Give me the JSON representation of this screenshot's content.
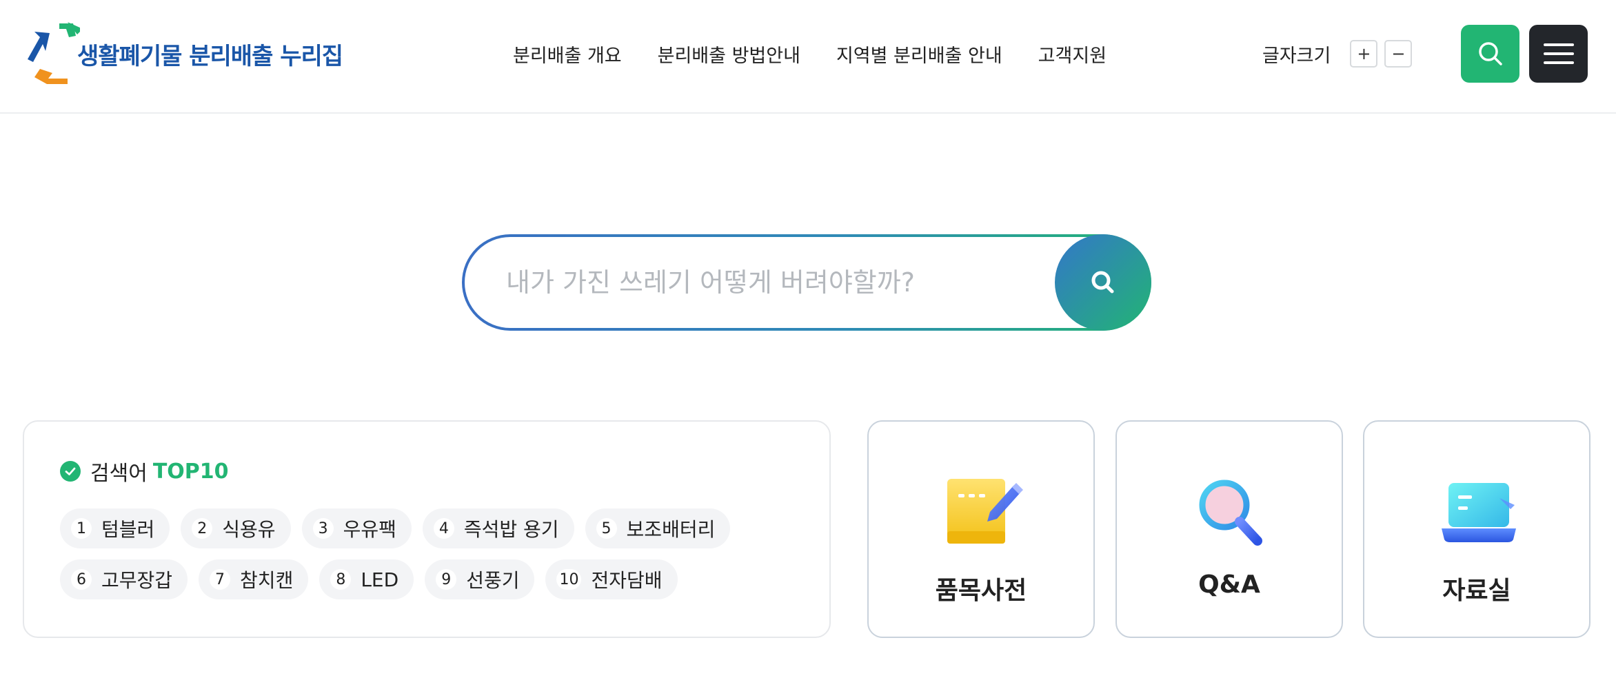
{
  "header": {
    "logo_text": "생활폐기물 분리배출 누리집",
    "nav": [
      {
        "label": "분리배출 개요"
      },
      {
        "label": "분리배출 방법안내"
      },
      {
        "label": "지역별 분리배출 안내"
      },
      {
        "label": "고객지원"
      }
    ],
    "font_size": {
      "label": "글자크기",
      "increase": "+",
      "decrease": "−"
    },
    "search_icon": "search-icon",
    "menu_icon": "hamburger-menu-icon"
  },
  "search": {
    "placeholder": "내가 가진 쓰레기 어떻게 버려야할까?",
    "value": "",
    "submit_icon": "search-icon"
  },
  "top10": {
    "title": "검색어",
    "title_accent": "TOP10",
    "rows": [
      [
        {
          "rank": "1",
          "label": "텀블러"
        },
        {
          "rank": "2",
          "label": "식용유"
        },
        {
          "rank": "3",
          "label": "우유팩"
        },
        {
          "rank": "4",
          "label": "즉석밥 용기"
        },
        {
          "rank": "5",
          "label": "보조배터리"
        }
      ],
      [
        {
          "rank": "6",
          "label": "고무장갑"
        },
        {
          "rank": "7",
          "label": "참치캔"
        },
        {
          "rank": "8",
          "label": "LED"
        },
        {
          "rank": "9",
          "label": "선풍기"
        },
        {
          "rank": "10",
          "label": "전자담배"
        }
      ]
    ]
  },
  "cards": [
    {
      "label": "품목사전",
      "icon": "notebook-pencil-icon"
    },
    {
      "label": "Q&A",
      "icon": "magnifier-icon"
    },
    {
      "label": "자료실",
      "icon": "laptop-icon"
    }
  ],
  "colors": {
    "brand_blue": "#1a56a8",
    "brand_green": "#22b573",
    "brand_orange": "#f0921e",
    "dark_button": "#23262b"
  }
}
